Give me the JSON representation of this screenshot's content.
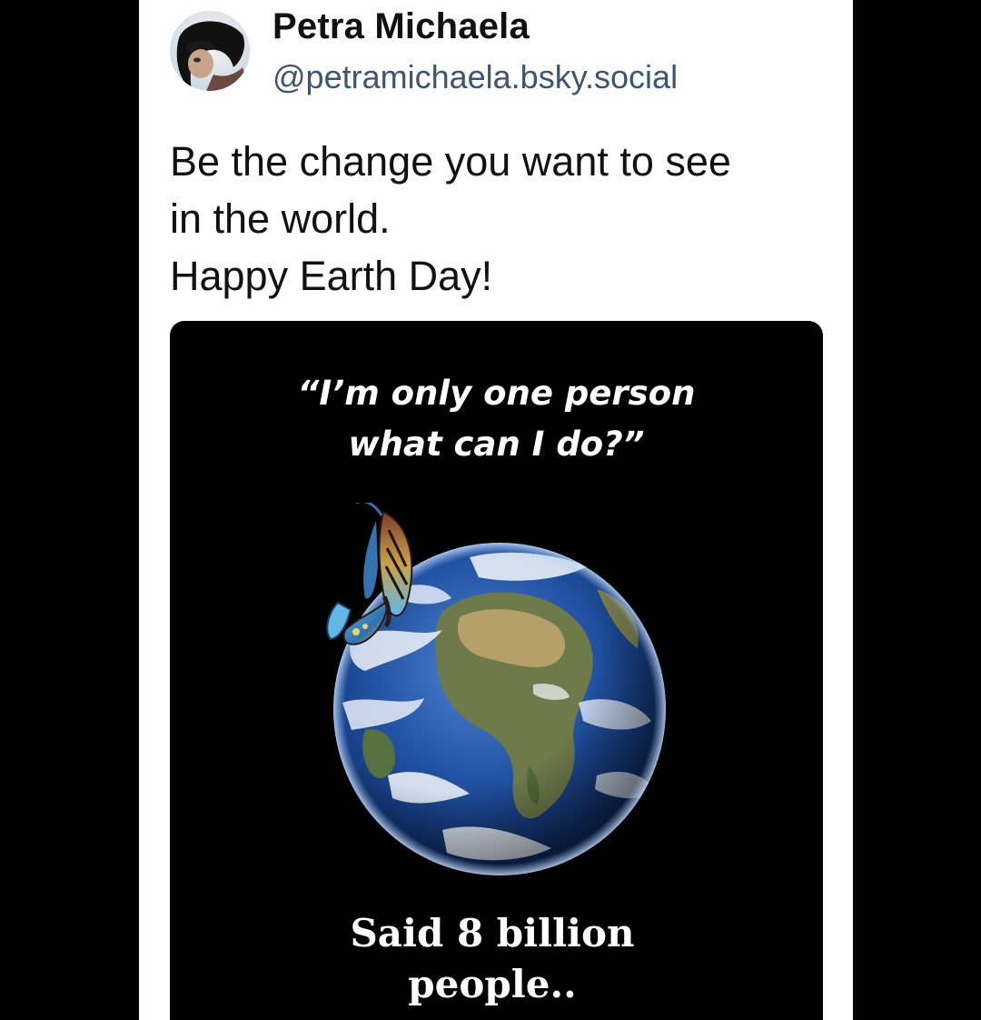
{
  "post": {
    "author": {
      "display_name": "Petra Michaela",
      "handle": "@petramichaela.bsky.social"
    },
    "text_lines": [
      "Be the change you want to see",
      "in the world.",
      "Happy Earth Day!"
    ],
    "image": {
      "quote_lines": [
        "“I’m only one person",
        "what can I do?”"
      ],
      "caption_lines": [
        "Said 8 billion",
        "people.."
      ],
      "icons": [
        "earth-globe",
        "butterfly"
      ]
    }
  },
  "colors": {
    "page_background": "#000000",
    "card_background": "#ffffff",
    "name_text": "#111111",
    "handle_text": "#3d5670",
    "media_background": "#000000",
    "media_text": "#ffffff"
  }
}
